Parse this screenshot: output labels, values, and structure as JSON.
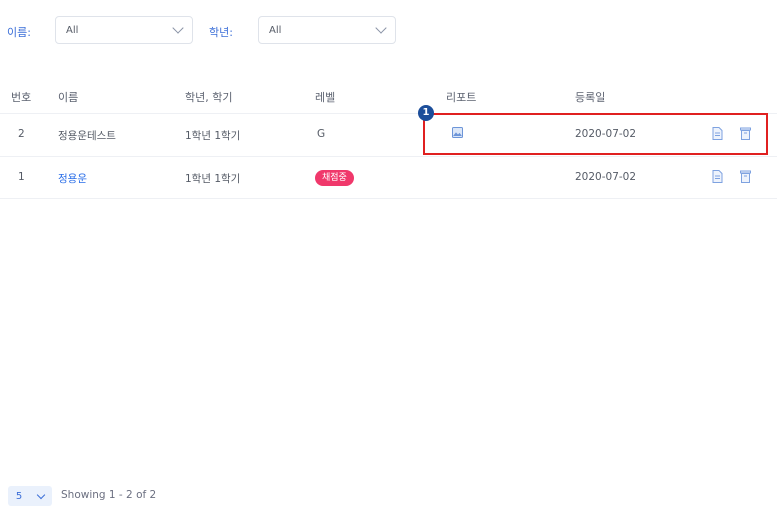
{
  "filters": {
    "name_label": "이름:",
    "name_value": "All",
    "grade_label": "학년:",
    "grade_value": "All"
  },
  "table": {
    "headers": [
      "번호",
      "이름",
      "학년, 학기",
      "레벨",
      "리포트",
      "등록일"
    ],
    "rows": [
      {
        "no": "2",
        "name": "정용운테스트",
        "grade": "1학년 1학기",
        "level": "G",
        "report_icon": "image-report-icon",
        "date": "2020-07-02"
      },
      {
        "no": "1",
        "name": "정용운",
        "grade": "1학년 1학기",
        "level_badge": "채점중",
        "date": "2020-07-02"
      }
    ]
  },
  "annotation": {
    "marker": "1"
  },
  "pagination": {
    "page_size": "5",
    "showing": "Showing 1 - 2 of 2"
  },
  "colors": {
    "accent": "#3c6fd8",
    "badge": "#f0386b",
    "highlight": "#e02020",
    "marker": "#1c4e9a"
  }
}
